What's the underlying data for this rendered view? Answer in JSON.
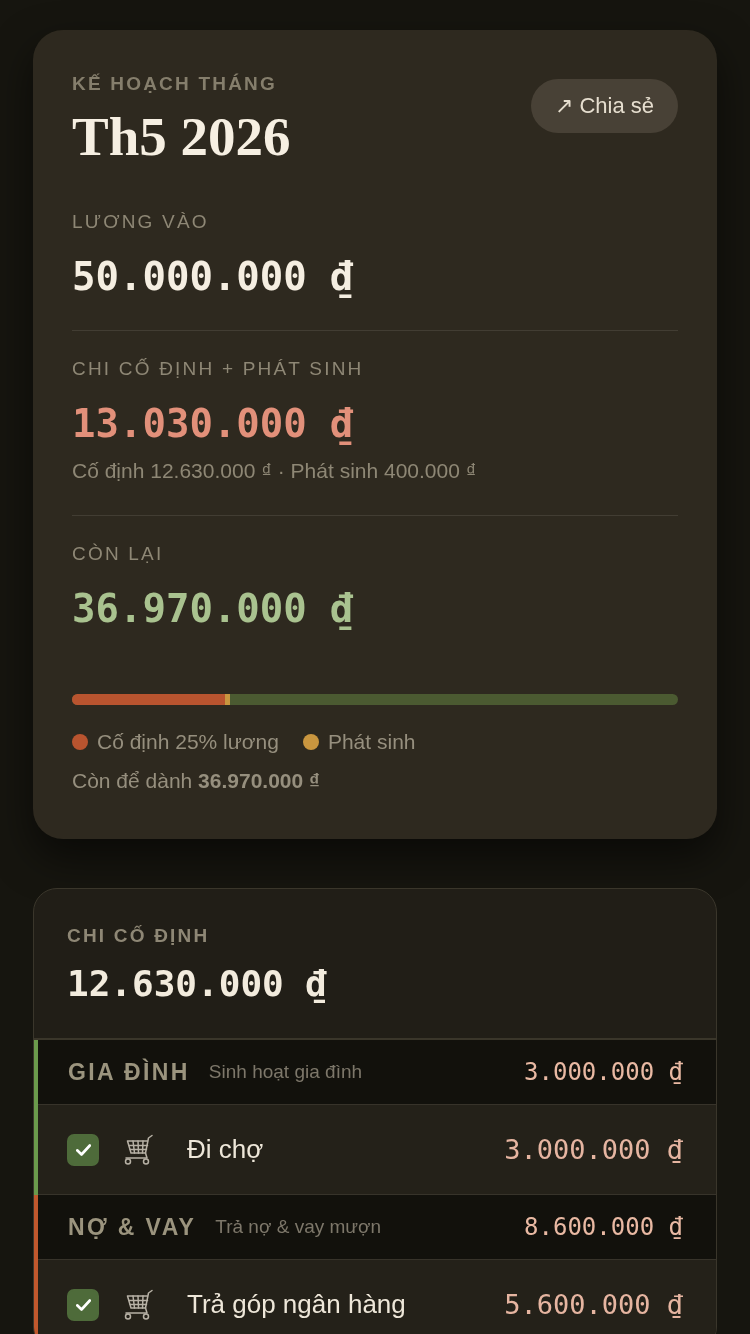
{
  "plan_card": {
    "eyebrow": "KẾ HOẠCH THÁNG",
    "title": "Th5 2026",
    "share_button": "↗ Chia sẻ",
    "stats": [
      {
        "kind": "income",
        "label": "LƯƠNG VÀO",
        "amount": "50.000.000 ₫"
      },
      {
        "kind": "expense",
        "label": "CHI CỐ ĐỊNH + PHÁT SINH",
        "amount": "13.030.000 ₫",
        "note": "Cố định 12.630.000 ₫ · Phát sinh 400.000 ₫"
      },
      {
        "kind": "balance",
        "label": "CÒN LẠI",
        "amount": "36.970.000 ₫"
      }
    ],
    "budget_bar": {
      "segments": [
        {
          "color": "#b9542f",
          "level": 0.2526
        },
        {
          "color": "#c9963f",
          "level": 0.008
        }
      ]
    },
    "legend": [
      {
        "label": "Cố định 25% lương",
        "color": "#b9542f"
      },
      {
        "label": "Phát sinh",
        "color": "#c9963f"
      }
    ],
    "savings_note": "Còn để dành **36.970.000 ₫**"
  },
  "fixed_costs": {
    "label": "CHI CỐ ĐỊNH",
    "total": "12.630.000 ₫",
    "groups": [
      {
        "name": "GIA ĐÌNH",
        "description": "Sinh hoạt gia đình",
        "total": "3.000.000 ₫",
        "color": "#6b9a4c",
        "items": [
          {
            "name": "Đi chợ",
            "amount": "3.000.000 ₫",
            "checked": true
          }
        ]
      },
      {
        "name": "NỢ & VAY",
        "description": "Trả nợ & vay mượn",
        "total": "8.600.000 ₫",
        "color": "#c1582d",
        "items": [
          {
            "name": "Trả góp ngân hàng",
            "amount": "5.600.000 ₫",
            "checked": true
          }
        ]
      }
    ]
  }
}
